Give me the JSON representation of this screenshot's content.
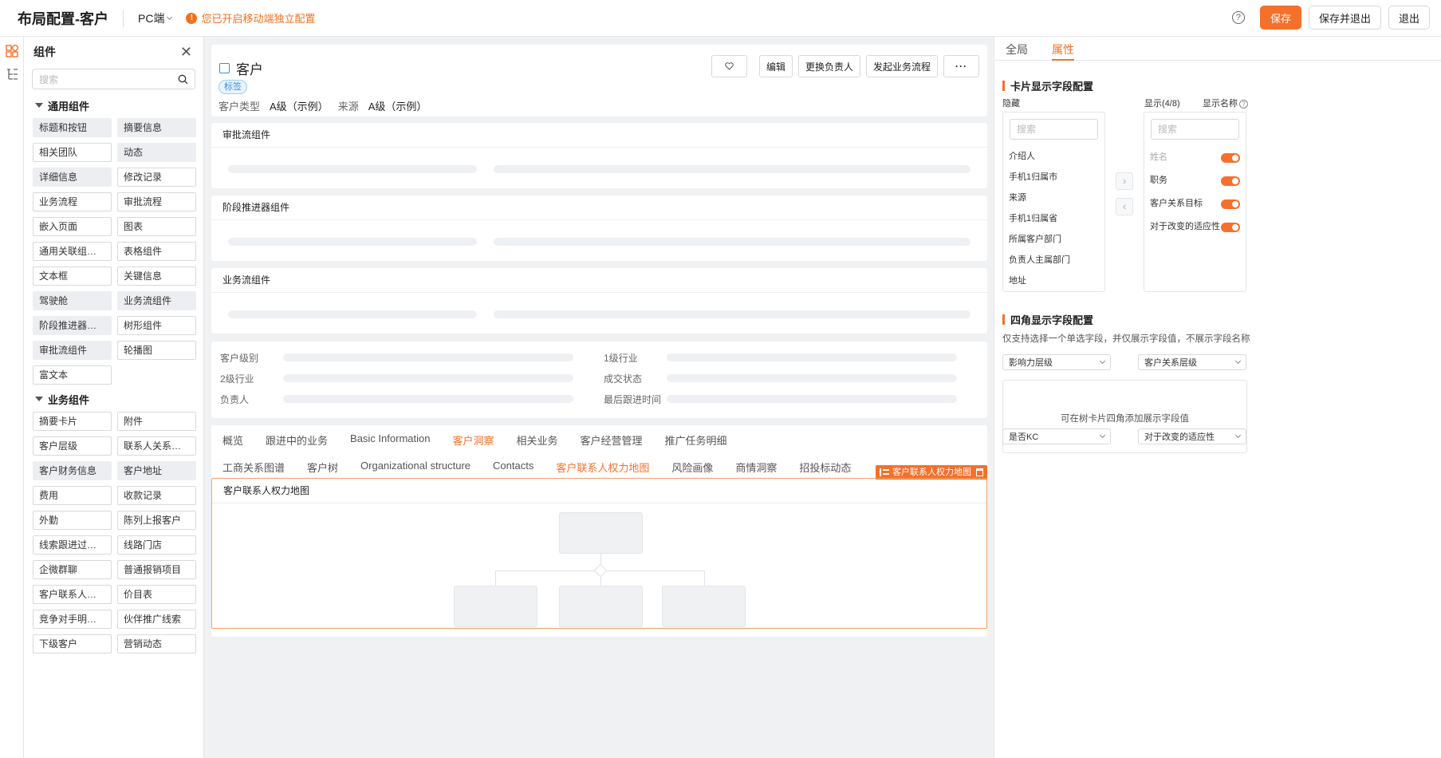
{
  "topbar": {
    "title": "布局配置-客户",
    "device": "PC端",
    "notice": "您已开启移动端独立配置",
    "save": "保存",
    "save_exit": "保存并退出",
    "exit": "退出"
  },
  "components": {
    "title": "组件",
    "search_placeholder": "搜索",
    "general_group": "通用组件",
    "general": [
      {
        "label": "标题和按钮",
        "used": true
      },
      {
        "label": "摘要信息",
        "used": true
      },
      {
        "label": "相关团队",
        "used": false
      },
      {
        "label": "动态",
        "used": true
      },
      {
        "label": "详细信息",
        "used": true
      },
      {
        "label": "修改记录",
        "used": false
      },
      {
        "label": "业务流程",
        "used": false
      },
      {
        "label": "审批流程",
        "used": false
      },
      {
        "label": "嵌入页面",
        "used": false
      },
      {
        "label": "图表",
        "used": false
      },
      {
        "label": "通用关联组件(...",
        "used": false
      },
      {
        "label": "表格组件",
        "used": false
      },
      {
        "label": "文本框",
        "used": false
      },
      {
        "label": "关键信息",
        "used": false
      },
      {
        "label": "驾驶舱",
        "used": true
      },
      {
        "label": "业务流组件",
        "used": true
      },
      {
        "label": "阶段推进器组件",
        "used": true
      },
      {
        "label": "树形组件",
        "used": false
      },
      {
        "label": "审批流组件",
        "used": true
      },
      {
        "label": "轮播图",
        "used": false
      },
      {
        "label": "富文本",
        "used": false
      }
    ],
    "business_group": "业务组件",
    "business": [
      {
        "label": "摘要卡片",
        "used": false
      },
      {
        "label": "附件",
        "used": false
      },
      {
        "label": "客户层级",
        "used": false
      },
      {
        "label": "联系人关系图谱",
        "used": false
      },
      {
        "label": "客户财务信息",
        "used": true
      },
      {
        "label": "客户地址",
        "used": true
      },
      {
        "label": "费用",
        "used": false
      },
      {
        "label": "收款记录",
        "used": false
      },
      {
        "label": "外勤",
        "used": false
      },
      {
        "label": "陈列上报客户",
        "used": false
      },
      {
        "label": "线索跟进过程记录",
        "used": false
      },
      {
        "label": "线路门店",
        "used": false
      },
      {
        "label": "企微群聊",
        "used": false
      },
      {
        "label": "普通报销项目",
        "used": false
      },
      {
        "label": "客户联系人关系",
        "used": false
      },
      {
        "label": "价目表",
        "used": false
      },
      {
        "label": "竞争对手明细列表",
        "used": false
      },
      {
        "label": "伙伴推广线索",
        "used": false
      },
      {
        "label": "下级客户",
        "used": false
      },
      {
        "label": "营销动态",
        "used": false
      }
    ]
  },
  "header_card": {
    "title": "客户",
    "tag": "标签",
    "field1_label": "客户类型",
    "field1_value": "A级（示例）",
    "field2_label": "来源",
    "field2_value": "A级（示例）",
    "actions": {
      "edit": "编辑",
      "change_owner": "更换负责人",
      "start_flow": "发起业务流程",
      "more": "···"
    }
  },
  "sections": {
    "approval": "审批流组件",
    "stage": "阶段推进器组件",
    "business": "业务流组件"
  },
  "info_fields": {
    "left": [
      "客户级别",
      "2级行业",
      "负责人"
    ],
    "right": [
      "1级行业",
      "成交状态",
      "最后跟进时间"
    ]
  },
  "tabs_row1": [
    {
      "label": "概览",
      "active": false
    },
    {
      "label": "跟进中的业务",
      "active": false
    },
    {
      "label": "Basic Information",
      "active": false
    },
    {
      "label": "客户洞察",
      "active": true
    },
    {
      "label": "相关业务",
      "active": false
    },
    {
      "label": "客户经营管理",
      "active": false
    },
    {
      "label": "推广任务明细",
      "active": false
    }
  ],
  "tabs_row2": [
    {
      "label": "工商关系图谱",
      "active": false
    },
    {
      "label": "客户树",
      "active": false
    },
    {
      "label": "Organizational structure",
      "active": false
    },
    {
      "label": "Contacts",
      "active": false
    },
    {
      "label": "客户联系人权力地图",
      "active": true
    },
    {
      "label": "风险画像",
      "active": false
    },
    {
      "label": "商情洞察",
      "active": false
    },
    {
      "label": "招投标动态",
      "active": false
    }
  ],
  "selected_component": {
    "label": "客户联系人权力地图",
    "title": "客户联系人权力地图"
  },
  "properties": {
    "tabs": {
      "global": "全局",
      "props": "属性"
    },
    "card_section": "卡片显示字段配置",
    "hidden_label": "隐藏",
    "shown_label": "显示(4/8)",
    "display_name_label": "显示名称",
    "search_placeholder": "搜索",
    "hidden_items": [
      "介绍人",
      "手机1归属市",
      "来源",
      "手机1归属省",
      "所属客户部门",
      "负责人主属部门",
      "地址"
    ],
    "shown_items": [
      {
        "label": "姓名",
        "disabled": true
      },
      {
        "label": "职务",
        "disabled": false
      },
      {
        "label": "客户关系目标",
        "disabled": false
      },
      {
        "label": "对于改变的适应性",
        "disabled": false
      }
    ],
    "corner_section": "四角显示字段配置",
    "corner_note": "仅支持选择一个单选字段，并仅展示字段值，不展示字段名称",
    "corner_tl": "影响力层级",
    "corner_tr": "客户关系层级",
    "corner_bl": "是否KC",
    "corner_br": "对于改变的适应性",
    "corner_hint": "可在树卡片四角添加展示字段值"
  },
  "colors": {
    "accent": "#f5702a",
    "tag_blue": "#3a8fd6"
  }
}
